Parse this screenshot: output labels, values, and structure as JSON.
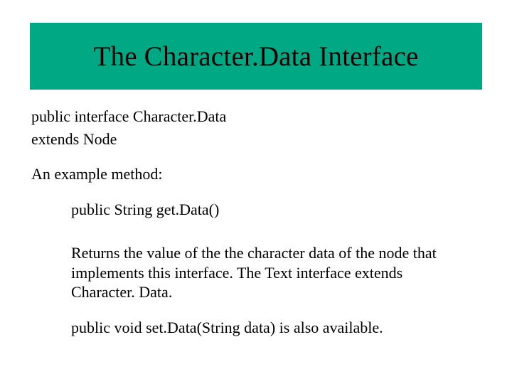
{
  "title": "The Character.Data Interface",
  "body": {
    "decl_line1": "public interface Character.Data",
    "decl_line2": "extends Node",
    "example_label": "An example method:",
    "method_sig": "public String get.Data()",
    "method_desc": "Returns the value of the the character data of the node that implements this interface. The Text interface extends Character. Data.",
    "setter_note": "public void  set.Data(String data) is also available."
  }
}
